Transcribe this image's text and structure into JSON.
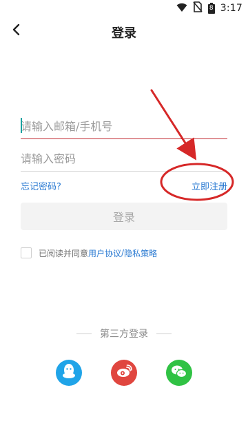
{
  "status": {
    "time": "3:17",
    "battery_level": "8",
    "icons": [
      "wifi-icon",
      "no-sim-icon",
      "battery-icon"
    ]
  },
  "header": {
    "title": "登录",
    "back_icon": "chevron-left-icon"
  },
  "form": {
    "email_placeholder": "请输入邮箱/手机号",
    "password_placeholder": "请输入密码",
    "forgot_label": "忘记密码?",
    "register_label": "立即注册",
    "login_label": "登录",
    "agree_prefix": "已阅读并同意",
    "user_agreement": "用户协议",
    "separator": "/",
    "privacy_policy": "隐私策略"
  },
  "third_party": {
    "label": "第三方登录",
    "providers": [
      "QQ",
      "Weibo",
      "WeChat"
    ]
  },
  "colors": {
    "accent_link": "#2a7ad2",
    "active_underline": "#c1272d",
    "qq": "#20a4e8",
    "weibo": "#e0463f",
    "wechat": "#30c244",
    "annotation_red": "#d62828"
  }
}
